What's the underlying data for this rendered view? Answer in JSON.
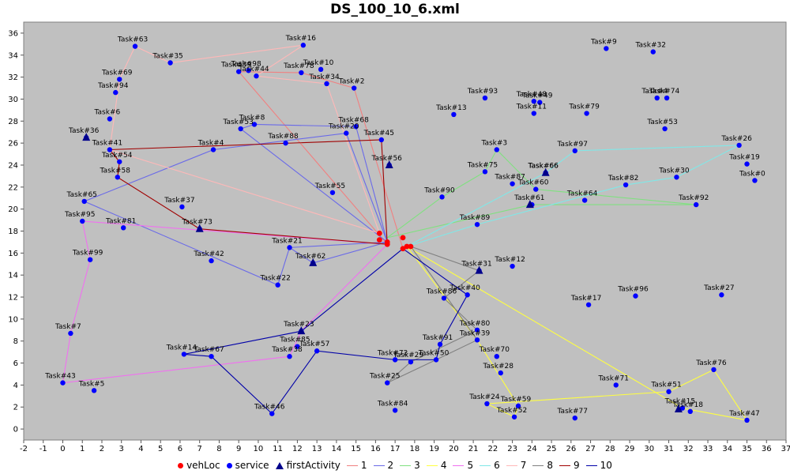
{
  "chart_data": {
    "type": "scatter",
    "title": "DS_100_10_6.xml",
    "xlim": [
      -2,
      37
    ],
    "ylim": [
      -1,
      37
    ],
    "x_ticks": [
      -2,
      -1,
      0,
      1,
      2,
      3,
      4,
      5,
      6,
      7,
      8,
      9,
      10,
      11,
      12,
      13,
      14,
      15,
      16,
      17,
      18,
      19,
      20,
      21,
      22,
      23,
      24,
      25,
      26,
      27,
      28,
      29,
      30,
      31,
      32,
      33,
      34,
      35,
      36,
      37
    ],
    "y_ticks": [
      0,
      2,
      4,
      6,
      8,
      10,
      12,
      14,
      16,
      18,
      20,
      22,
      24,
      26,
      28,
      30,
      32,
      34,
      36
    ],
    "grid": false,
    "plot_background": "#c0c0c0",
    "legend_position": "bottom",
    "legend": [
      {
        "label": "vehLoc",
        "kind": "dot",
        "color": "#ff0000"
      },
      {
        "label": "service",
        "kind": "dot",
        "color": "#0000ff"
      },
      {
        "label": "firstActivity",
        "kind": "triangle",
        "color": "#00008b"
      },
      {
        "label": "1",
        "kind": "line",
        "color": "#f08080"
      },
      {
        "label": "2",
        "kind": "line",
        "color": "#6a6ae8"
      },
      {
        "label": "3",
        "kind": "line",
        "color": "#80e080"
      },
      {
        "label": "4",
        "kind": "line",
        "color": "#ffff40"
      },
      {
        "label": "5",
        "kind": "line",
        "color": "#f070f0"
      },
      {
        "label": "6",
        "kind": "line",
        "color": "#80e8e8"
      },
      {
        "label": "7",
        "kind": "line",
        "color": "#ffb8b8"
      },
      {
        "label": "8",
        "kind": "line",
        "color": "#808080"
      },
      {
        "label": "9",
        "kind": "line",
        "color": "#a00000"
      },
      {
        "label": "10",
        "kind": "line",
        "color": "#0000a8"
      }
    ],
    "vehicle_locations": [
      [
        16.2,
        17.8
      ],
      [
        16.2,
        17.2
      ],
      [
        16.6,
        17.0
      ],
      [
        16.6,
        16.8
      ],
      [
        17.4,
        17.4
      ],
      [
        17.4,
        16.4
      ],
      [
        17.6,
        16.6
      ],
      [
        17.8,
        16.6
      ]
    ],
    "tasks": [
      {
        "name": "Task#63",
        "x": 3.7,
        "y": 34.8
      },
      {
        "name": "Task#16",
        "x": 12.3,
        "y": 34.9
      },
      {
        "name": "Task#35",
        "x": 5.5,
        "y": 33.3
      },
      {
        "name": "Task#98",
        "x": 9.5,
        "y": 32.6
      },
      {
        "name": "Task#39",
        "x": 9.0,
        "y": 32.5
      },
      {
        "name": "Task#44",
        "x": 9.9,
        "y": 32.1
      },
      {
        "name": "Task#78",
        "x": 12.2,
        "y": 32.4
      },
      {
        "name": "Task#10",
        "x": 13.2,
        "y": 32.7
      },
      {
        "name": "Task#34",
        "x": 13.5,
        "y": 31.4
      },
      {
        "name": "Task#2",
        "x": 14.9,
        "y": 31.0
      },
      {
        "name": "Task#69",
        "x": 2.9,
        "y": 31.8
      },
      {
        "name": "Task#94",
        "x": 2.7,
        "y": 30.6
      },
      {
        "name": "Task#6",
        "x": 2.4,
        "y": 28.2
      },
      {
        "name": "Task#8",
        "x": 9.8,
        "y": 27.7
      },
      {
        "name": "Task#53",
        "x": 9.1,
        "y": 27.3
      },
      {
        "name": "Task#68",
        "x": 15.0,
        "y": 27.5
      },
      {
        "name": "Task#20",
        "x": 14.5,
        "y": 26.9
      },
      {
        "name": "Task#45",
        "x": 16.3,
        "y": 26.3
      },
      {
        "name": "Task#41",
        "x": 2.4,
        "y": 25.4
      },
      {
        "name": "Task#88",
        "x": 11.4,
        "y": 26.0
      },
      {
        "name": "Task#4",
        "x": 7.7,
        "y": 25.4
      },
      {
        "name": "Task#54",
        "x": 2.9,
        "y": 24.3
      },
      {
        "name": "Task#58",
        "x": 2.8,
        "y": 22.9
      },
      {
        "name": "Task#55",
        "x": 13.8,
        "y": 21.5
      },
      {
        "name": "Task#65",
        "x": 1.1,
        "y": 20.7
      },
      {
        "name": "Task#37",
        "x": 6.1,
        "y": 20.2
      },
      {
        "name": "Task#95",
        "x": 1.0,
        "y": 18.9
      },
      {
        "name": "Task#81",
        "x": 3.1,
        "y": 18.3
      },
      {
        "name": "Task#21",
        "x": 11.6,
        "y": 16.5
      },
      {
        "name": "Task#42",
        "x": 7.6,
        "y": 15.3
      },
      {
        "name": "Task#99",
        "x": 1.4,
        "y": 15.4
      },
      {
        "name": "Task#22",
        "x": 11.0,
        "y": 13.1
      },
      {
        "name": "Task#7",
        "x": 0.4,
        "y": 8.7
      },
      {
        "name": "Task#23",
        "x": 12.2,
        "y": 8.9
      },
      {
        "name": "Task#85",
        "x": 12.0,
        "y": 7.5
      },
      {
        "name": "Task#14",
        "x": 6.2,
        "y": 6.8
      },
      {
        "name": "Task#67",
        "x": 7.6,
        "y": 6.6
      },
      {
        "name": "Task#38",
        "x": 11.6,
        "y": 6.6
      },
      {
        "name": "Task#57",
        "x": 13.0,
        "y": 7.1
      },
      {
        "name": "Task#43",
        "x": 0.0,
        "y": 4.2
      },
      {
        "name": "Task#5",
        "x": 1.6,
        "y": 3.5
      },
      {
        "name": "Task#46",
        "x": 10.7,
        "y": 1.4
      },
      {
        "name": "Task#72",
        "x": 17.0,
        "y": 6.3
      },
      {
        "name": "Task#29",
        "x": 17.8,
        "y": 6.1
      },
      {
        "name": "Task#50",
        "x": 19.1,
        "y": 6.3
      },
      {
        "name": "Task#91",
        "x": 19.3,
        "y": 7.7
      },
      {
        "name": "Task#25",
        "x": 16.6,
        "y": 4.2
      },
      {
        "name": "Task#84",
        "x": 17.0,
        "y": 1.7
      },
      {
        "name": "Task#13",
        "x": 20.0,
        "y": 28.6
      },
      {
        "name": "Task#93",
        "x": 21.6,
        "y": 30.1
      },
      {
        "name": "Task#3",
        "x": 22.2,
        "y": 25.4
      },
      {
        "name": "Task#75",
        "x": 21.6,
        "y": 23.4
      },
      {
        "name": "Task#90",
        "x": 19.4,
        "y": 21.1
      },
      {
        "name": "Task#87",
        "x": 23.0,
        "y": 22.3
      },
      {
        "name": "Task#60",
        "x": 24.2,
        "y": 21.8
      },
      {
        "name": "Task#61",
        "x": 24.0,
        "y": 20.4
      },
      {
        "name": "Task#89",
        "x": 21.2,
        "y": 18.6
      },
      {
        "name": "Task#12",
        "x": 23.0,
        "y": 14.8
      },
      {
        "name": "Task#31",
        "x": 21.3,
        "y": 14.4
      },
      {
        "name": "Task#86",
        "x": 19.5,
        "y": 11.9
      },
      {
        "name": "Task#40",
        "x": 20.7,
        "y": 12.2
      },
      {
        "name": "Task#80",
        "x": 21.2,
        "y": 9.0
      },
      {
        "name": "Task#39",
        "x": 21.2,
        "y": 8.1
      },
      {
        "name": "Task#70",
        "x": 22.2,
        "y": 6.6
      },
      {
        "name": "Task#28",
        "x": 22.4,
        "y": 5.1
      },
      {
        "name": "Task#24",
        "x": 21.7,
        "y": 2.3
      },
      {
        "name": "Task#59",
        "x": 23.3,
        "y": 2.1
      },
      {
        "name": "Task#52",
        "x": 23.1,
        "y": 1.1
      },
      {
        "name": "Task#9",
        "x": 27.8,
        "y": 34.6
      },
      {
        "name": "Task#32",
        "x": 30.2,
        "y": 34.3
      },
      {
        "name": "Task#49",
        "x": 24.4,
        "y": 29.7
      },
      {
        "name": "Task#48",
        "x": 24.1,
        "y": 29.8
      },
      {
        "name": "Task#11",
        "x": 24.1,
        "y": 28.7
      },
      {
        "name": "Task#74",
        "x": 30.9,
        "y": 30.1
      },
      {
        "name": "Task#4",
        "x": 30.4,
        "y": 30.1
      },
      {
        "name": "Task#79",
        "x": 26.8,
        "y": 28.7
      },
      {
        "name": "Task#53",
        "x": 30.8,
        "y": 27.3
      },
      {
        "name": "Task#97",
        "x": 26.2,
        "y": 25.3
      },
      {
        "name": "Task#66",
        "x": 24.7,
        "y": 23.3
      },
      {
        "name": "Task#26",
        "x": 34.6,
        "y": 25.8
      },
      {
        "name": "Task#19",
        "x": 35.0,
        "y": 24.1
      },
      {
        "name": "Task#30",
        "x": 31.4,
        "y": 22.9
      },
      {
        "name": "Task#0",
        "x": 35.4,
        "y": 22.6
      },
      {
        "name": "Task#82",
        "x": 28.8,
        "y": 22.2
      },
      {
        "name": "Task#64",
        "x": 26.7,
        "y": 20.8
      },
      {
        "name": "Task#92",
        "x": 32.4,
        "y": 20.4
      },
      {
        "name": "Task#17",
        "x": 26.9,
        "y": 11.3
      },
      {
        "name": "Task#96",
        "x": 29.3,
        "y": 12.1
      },
      {
        "name": "Task#27",
        "x": 33.7,
        "y": 12.2
      },
      {
        "name": "Task#71",
        "x": 28.3,
        "y": 4.0
      },
      {
        "name": "Task#51",
        "x": 31.0,
        "y": 3.4
      },
      {
        "name": "Task#76",
        "x": 33.3,
        "y": 5.4
      },
      {
        "name": "Task#15",
        "x": 31.7,
        "y": 1.9
      },
      {
        "name": "Task#18",
        "x": 32.1,
        "y": 1.6
      },
      {
        "name": "Task#77",
        "x": 26.2,
        "y": 1.0
      },
      {
        "name": "Task#47",
        "x": 35.0,
        "y": 0.8
      },
      {
        "name": "Task#36",
        "x": 1.2,
        "y": 26.5
      },
      {
        "name": "Task#73",
        "x": 7.0,
        "y": 18.2
      },
      {
        "name": "Task#62",
        "x": 12.8,
        "y": 15.1
      },
      {
        "name": "Task#56",
        "x": 16.7,
        "y": 24.0
      },
      {
        "name": "Task#66",
        "x": 24.7,
        "y": 23.3
      }
    ],
    "first_activities": [
      [
        1.2,
        26.5
      ],
      [
        7.0,
        18.2
      ],
      [
        12.8,
        15.1
      ],
      [
        16.7,
        24.0
      ],
      [
        24.7,
        23.3
      ],
      [
        23.9,
        20.4
      ],
      [
        21.3,
        14.4
      ],
      [
        12.2,
        8.9
      ],
      [
        31.5,
        1.8
      ]
    ],
    "routes": [
      {
        "name": "1",
        "color": "#f08080",
        "points": [
          [
            17.4,
            16.4
          ],
          [
            14.9,
            31.0
          ],
          [
            12.2,
            32.4
          ],
          [
            9.0,
            32.5
          ],
          [
            16.6,
            16.8
          ]
        ]
      },
      {
        "name": "2",
        "color": "#6a6ae8",
        "points": [
          [
            16.6,
            17.0
          ],
          [
            15.0,
            27.5
          ],
          [
            9.8,
            27.7
          ],
          [
            9.1,
            27.3
          ],
          [
            16.6,
            17.0
          ],
          [
            12.8,
            15.1
          ],
          [
            11.6,
            16.5
          ],
          [
            11.0,
            13.1
          ],
          [
            1.1,
            20.7
          ],
          [
            7.7,
            25.4
          ],
          [
            14.5,
            26.9
          ],
          [
            16.6,
            17.0
          ],
          [
            11.6,
            16.5
          ]
        ]
      },
      {
        "name": "3",
        "color": "#80e080",
        "points": [
          [
            16.6,
            17.4
          ],
          [
            19.4,
            21.1
          ],
          [
            21.6,
            23.4
          ],
          [
            22.2,
            25.4
          ],
          [
            24.2,
            21.8
          ],
          [
            32.4,
            20.4
          ],
          [
            24.0,
            20.4
          ],
          [
            16.6,
            17.4
          ]
        ]
      },
      {
        "name": "4",
        "color": "#ffff40",
        "points": [
          [
            17.6,
            16.6
          ],
          [
            21.2,
            8.1
          ],
          [
            23.3,
            2.1
          ],
          [
            23.1,
            1.1
          ],
          [
            21.7,
            2.3
          ],
          [
            31.0,
            3.4
          ],
          [
            33.3,
            5.4
          ],
          [
            35.0,
            0.8
          ],
          [
            31.7,
            1.9
          ],
          [
            17.6,
            16.6
          ]
        ]
      },
      {
        "name": "5",
        "color": "#f070f0",
        "points": [
          [
            16.6,
            16.8
          ],
          [
            12.2,
            8.9
          ],
          [
            11.6,
            6.6
          ],
          [
            0.0,
            4.2
          ],
          [
            0.4,
            8.7
          ],
          [
            1.4,
            15.4
          ],
          [
            1.0,
            18.9
          ],
          [
            16.6,
            16.8
          ]
        ]
      },
      {
        "name": "6",
        "color": "#80e8e8",
        "points": [
          [
            17.6,
            16.6
          ],
          [
            24.7,
            23.3
          ],
          [
            26.2,
            25.3
          ],
          [
            34.6,
            25.8
          ],
          [
            31.4,
            22.9
          ],
          [
            28.8,
            22.2
          ],
          [
            21.2,
            18.6
          ],
          [
            17.6,
            16.6
          ]
        ]
      },
      {
        "name": "7",
        "color": "#ffb8b8",
        "points": [
          [
            16.2,
            17.8
          ],
          [
            13.5,
            31.4
          ],
          [
            9.9,
            32.1
          ],
          [
            12.3,
            34.9
          ],
          [
            5.5,
            33.3
          ],
          [
            3.7,
            34.8
          ],
          [
            2.9,
            31.8
          ],
          [
            2.4,
            25.4
          ],
          [
            16.2,
            17.8
          ]
        ]
      },
      {
        "name": "8",
        "color": "#808080",
        "points": [
          [
            17.8,
            16.6
          ],
          [
            21.3,
            14.4
          ],
          [
            19.5,
            11.9
          ],
          [
            21.2,
            9.0
          ],
          [
            17.8,
            6.1
          ],
          [
            16.6,
            4.2
          ],
          [
            19.1,
            6.3
          ],
          [
            21.2,
            8.1
          ],
          [
            17.8,
            16.6
          ]
        ]
      },
      {
        "name": "9",
        "color": "#a00000",
        "points": [
          [
            16.6,
            16.8
          ],
          [
            16.3,
            26.3
          ],
          [
            2.4,
            25.4
          ],
          [
            2.9,
            24.3
          ],
          [
            2.8,
            22.9
          ],
          [
            7.0,
            18.2
          ],
          [
            16.6,
            16.8
          ]
        ]
      },
      {
        "name": "10",
        "color": "#0000a8",
        "points": [
          [
            17.4,
            16.4
          ],
          [
            20.7,
            12.2
          ],
          [
            19.3,
            7.7
          ],
          [
            19.1,
            6.3
          ],
          [
            17.0,
            6.3
          ],
          [
            13.0,
            7.1
          ],
          [
            10.7,
            1.4
          ],
          [
            7.6,
            6.6
          ],
          [
            6.2,
            6.8
          ],
          [
            12.2,
            8.9
          ],
          [
            17.4,
            16.4
          ]
        ]
      }
    ]
  }
}
